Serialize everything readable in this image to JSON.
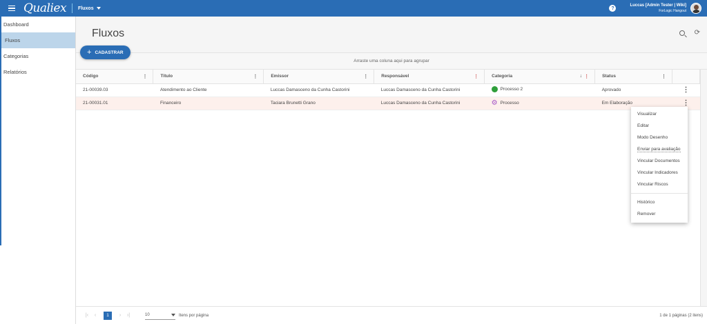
{
  "header": {
    "logo": "Qualiex",
    "module": "Fluxos",
    "help": "?",
    "user_name": "Luccas [Admin Tester | Wiki]",
    "user_org": "ForLogic Hangout"
  },
  "sidebar": {
    "items": [
      {
        "label": "Dashboard"
      },
      {
        "label": "Fluxos"
      },
      {
        "label": "Categorias"
      },
      {
        "label": "Relatórios"
      }
    ]
  },
  "page": {
    "title": "Fluxos",
    "add_label": "CADASTRAR",
    "group_hint": "Arraste uma coluna aqui para agrupar"
  },
  "table": {
    "columns": [
      "Código",
      "Título",
      "Emissor",
      "Responsável",
      "Categoria",
      "Status"
    ],
    "rows": [
      {
        "code": "21-00039.03",
        "title": "Atendimento ao Cliente",
        "emitter": "Luccas Damasceno da Cunha Castorini",
        "responsible": "Luccas Damasceno da Cunha Castorini",
        "category": "Processo 2",
        "status": "Aprovado"
      },
      {
        "code": "21-00031.01",
        "title": "Financeiro",
        "emitter": "Taciara Brunetti Grano",
        "responsible": "Luccas Damasceno da Cunha Castorini",
        "category": "Processo",
        "status": "Em Elaboração"
      }
    ]
  },
  "context_menu": {
    "items": [
      "Visualizar",
      "Editar",
      "Modo Desenho",
      "Enviar para avaliação",
      "Vincular Documentos",
      "Vincular Indicadores",
      "Vincular Riscos",
      "Histórico",
      "Remover"
    ]
  },
  "pager": {
    "page": "1",
    "page_size": "10",
    "page_size_label": "Itens por página",
    "info": "1 de 1 páginas (2 itens)"
  },
  "colors": {
    "primary": "#2a6db5",
    "selected_row": "#fdf0ec",
    "category_dot": "#2e9e3a",
    "gear": "#a455c7"
  }
}
